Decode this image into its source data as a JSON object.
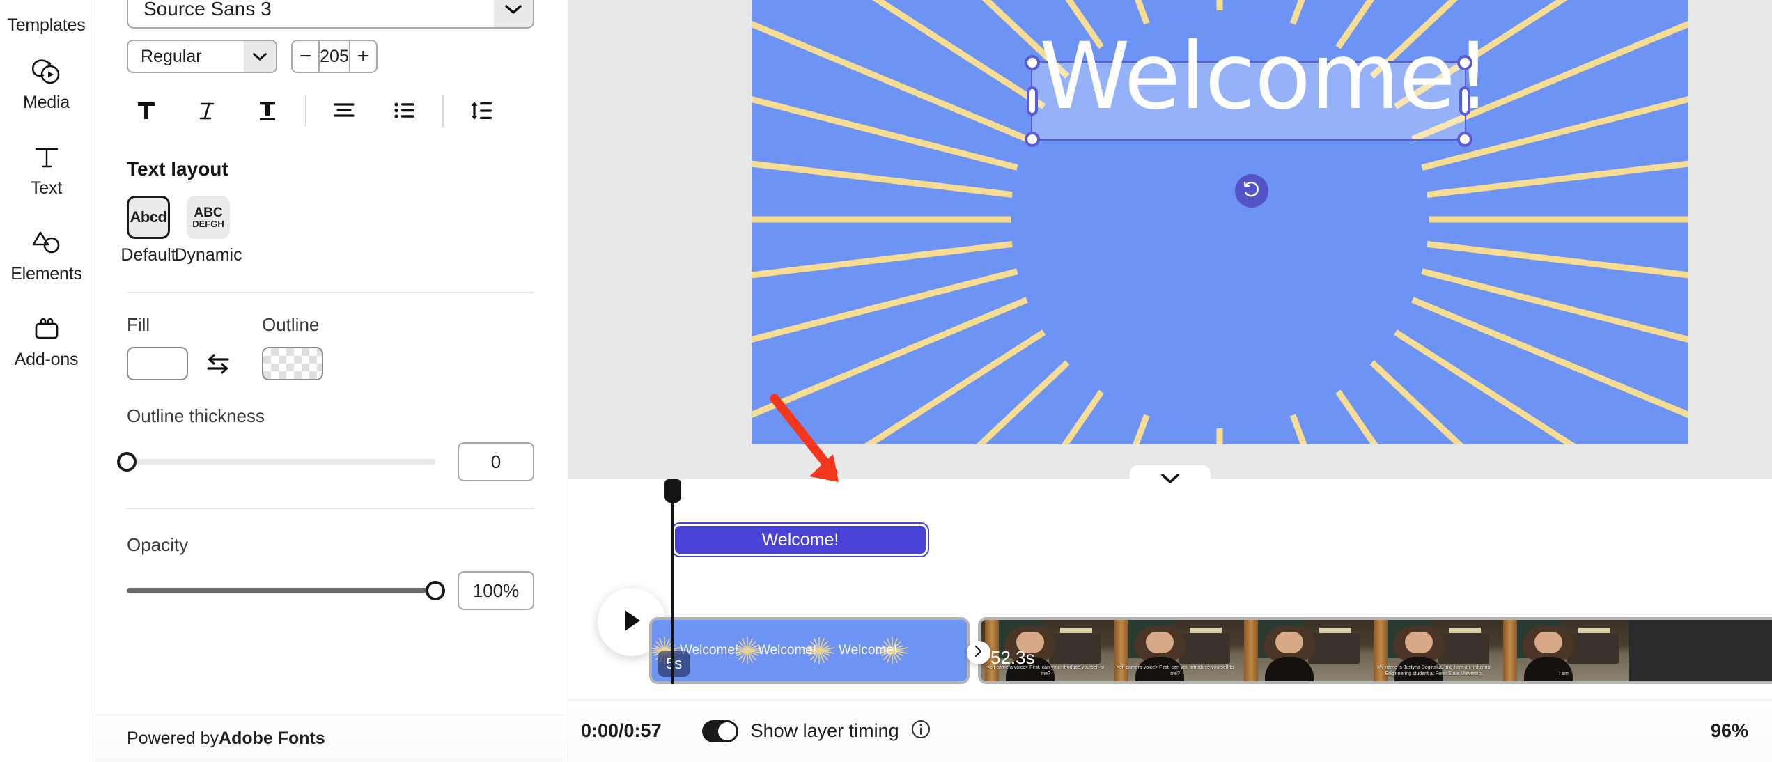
{
  "rail": {
    "items": [
      {
        "label": "Templates",
        "icon": "templates-icon"
      },
      {
        "label": "Media",
        "icon": "media-icon"
      },
      {
        "label": "Text",
        "icon": "text-icon"
      },
      {
        "label": "Elements",
        "icon": "elements-icon"
      },
      {
        "label": "Add-ons",
        "icon": "addons-icon"
      }
    ]
  },
  "panel": {
    "font_family": "Source Sans 3",
    "font_style": "Regular",
    "font_size": "205",
    "stepper_minus": "−",
    "stepper_plus": "+",
    "format_buttons": [
      {
        "name": "bold-icon",
        "label": "T"
      },
      {
        "name": "italic-icon",
        "label": "T"
      },
      {
        "name": "underline-icon",
        "label": "T"
      },
      {
        "name": "align-icon",
        "label": "align"
      },
      {
        "name": "list-icon",
        "label": "list"
      },
      {
        "name": "line-spacing-icon",
        "label": "line-spacing"
      }
    ],
    "text_layout_title": "Text layout",
    "layout_options": [
      {
        "label": "Default",
        "tile": "Abcd",
        "selected": true
      },
      {
        "label": "Dynamic",
        "tile_top": "ABC",
        "tile_bottom": "DEFGH",
        "selected": false
      }
    ],
    "fill_label": "Fill",
    "outline_label": "Outline",
    "fill_color": "#ffffff",
    "outline_color": "transparent",
    "outline_thickness_label": "Outline thickness",
    "outline_thickness_value": "0",
    "opacity_label": "Opacity",
    "opacity_value": "100%",
    "footer_prefix": "Powered by ",
    "footer_brand": "Adobe Fonts"
  },
  "canvas": {
    "artboard_bg": "#6d93f5",
    "ray_color": "#f7dd92",
    "selected_text": "Welcome!",
    "selection_color": "#5b5bd6",
    "rotate_icon": "rotate-ccw-icon"
  },
  "timeline": {
    "collapse_icon": "chevron-down-icon",
    "play_icon": "play-icon",
    "layer_bar_label": "Welcome!",
    "layer_bar_color": "#4a42d6",
    "clip_a": {
      "duration_badge": "5s",
      "labels": [
        "Welcome!",
        "Welcome!",
        "Welcome!"
      ]
    },
    "clip_b": {
      "duration_badge": "52.3s",
      "captions": [
        "<off camera voice> First, can you introduce yourself to me?",
        "<off camera voice> First, can you introduce yourself to me?",
        "",
        "My name is Justyna Boginska, and I am an Industrial Engineering student at Penn State University.",
        "I am"
      ]
    },
    "expand_icon": "chevron-right-double-icon"
  },
  "bottom_bar": {
    "time": "0:00/0:57",
    "toggle_on": true,
    "toggle_label": "Show layer timing",
    "info_icon": "info-icon",
    "zoom": "96%"
  }
}
